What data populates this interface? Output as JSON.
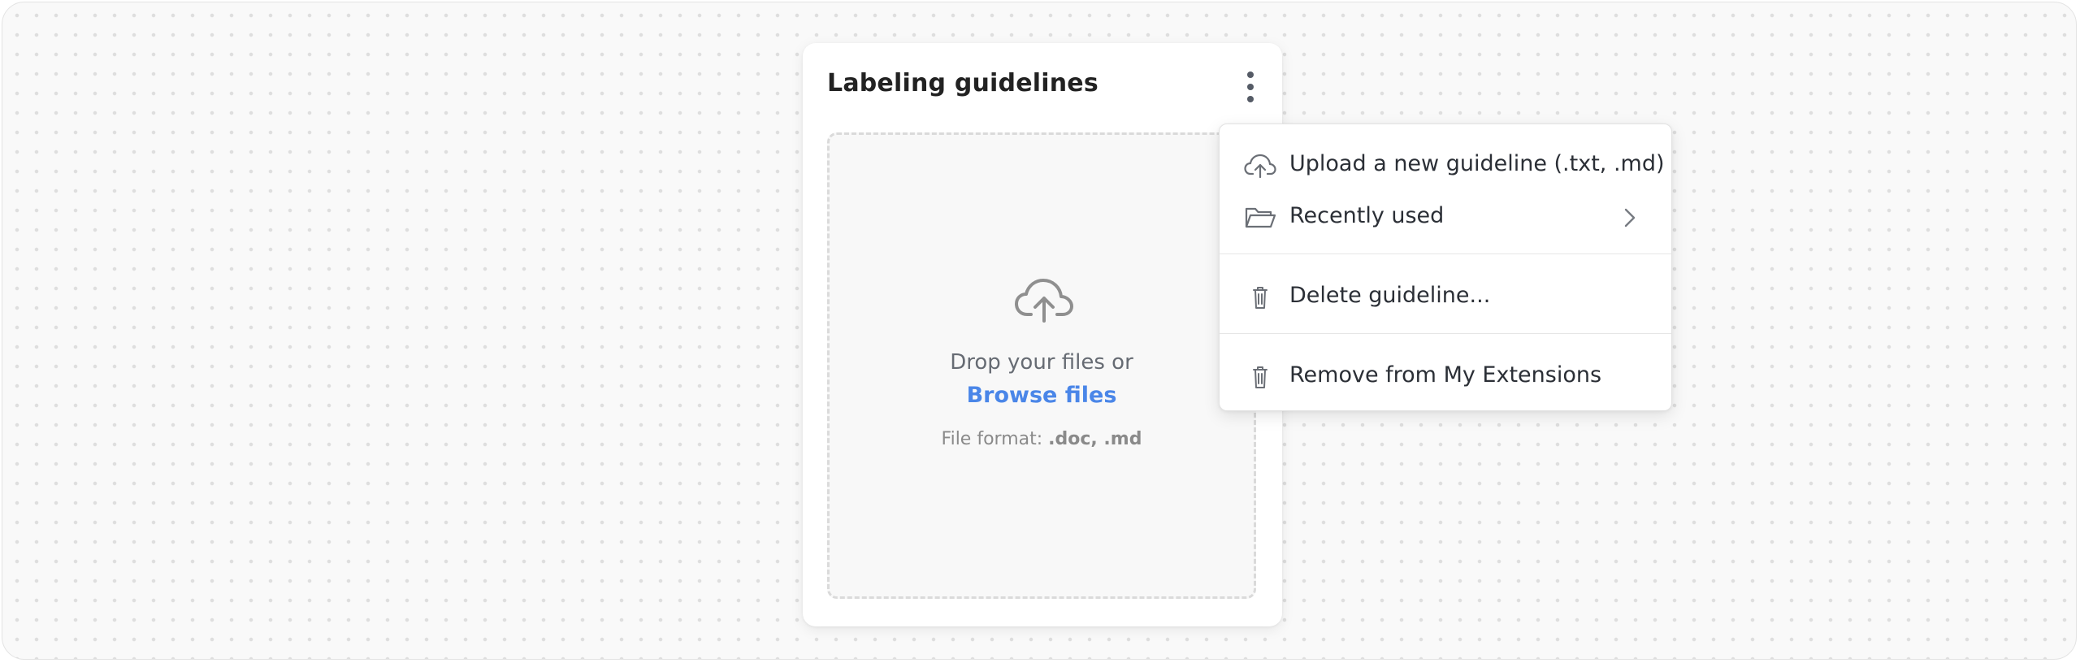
{
  "card": {
    "title": "Labeling guidelines",
    "menu_button_icon": "more-vertical-icon"
  },
  "dropzone": {
    "icon": "cloud-upload-icon",
    "drop_text": "Drop your files or",
    "browse_label": "Browse files",
    "format_prefix": "File format:",
    "format_values": ".doc, .md",
    "link_color": "#4a86e8"
  },
  "menu": {
    "items": [
      {
        "icon": "cloud-upload-icon",
        "label": "Upload a new guideline (.txt, .md)"
      },
      {
        "icon": "folder-open-icon",
        "label": "Recently used",
        "submenu_icon": "chevron-right-icon"
      },
      {
        "icon": "trash-icon",
        "label": "Delete guideline..."
      },
      {
        "icon": "trash-icon",
        "label": "Remove from My Extensions"
      }
    ]
  }
}
